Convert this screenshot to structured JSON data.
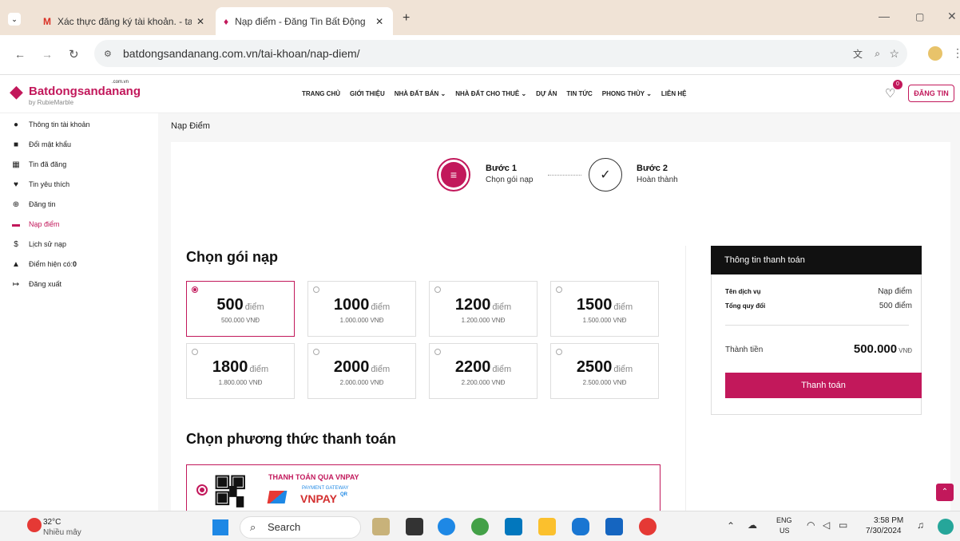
{
  "browser": {
    "tabs": [
      {
        "title": "Xác thực đăng ký tài khoản. - ta"
      },
      {
        "title": "Nạp điểm - Đăng Tin Bất Động"
      }
    ],
    "url": "batdongsandanang.com.vn/tai-khoan/nap-diem/"
  },
  "site": {
    "logo_main": "Batdongsandanang",
    "logo_tld": ".com.vn",
    "logo_sub": "by RubieMarble",
    "nav": [
      "TRANG CHỦ",
      "GIỚI THIỆU",
      "NHÀ ĐẤT BÁN",
      "NHÀ ĐẤT CHO THUÊ",
      "DỰ ÁN",
      "TIN TỨC",
      "PHONG THỦY",
      "LIÊN HỆ"
    ],
    "fav_count": "0",
    "post_button": "ĐĂNG TIN"
  },
  "sidebar": {
    "items": [
      {
        "label": "Thông tin tài khoản"
      },
      {
        "label": "Đổi mật khẩu"
      },
      {
        "label": "Tin đã đăng"
      },
      {
        "label": "Tin yêu thích"
      },
      {
        "label": "Đăng tin"
      },
      {
        "label": "Nạp điểm"
      },
      {
        "label": "Lịch sử nạp"
      },
      {
        "label": "Điểm hiện có: "
      },
      {
        "label": "Đăng xuất"
      }
    ],
    "points_value": "0"
  },
  "page": {
    "title": "Nạp Điểm",
    "steps": [
      {
        "title": "Bước 1",
        "desc": "Chọn gói nạp"
      },
      {
        "title": "Bước 2",
        "desc": "Hoàn thành"
      }
    ],
    "choose_package": "Chọn gói nạp",
    "unit": "điểm",
    "packages": [
      {
        "points": "500",
        "price": "500.000 VNĐ",
        "selected": true
      },
      {
        "points": "1000",
        "price": "1.000.000 VNĐ",
        "selected": false
      },
      {
        "points": "1200",
        "price": "1.200.000 VNĐ",
        "selected": false
      },
      {
        "points": "1500",
        "price": "1.500.000 VNĐ",
        "selected": false
      },
      {
        "points": "1800",
        "price": "1.800.000 VNĐ",
        "selected": false
      },
      {
        "points": "2000",
        "price": "2.000.000 VNĐ",
        "selected": false
      },
      {
        "points": "2200",
        "price": "2.200.000 VNĐ",
        "selected": false
      },
      {
        "points": "2500",
        "price": "2.500.000 VNĐ",
        "selected": false
      }
    ],
    "choose_method": "Chọn phương thức thanh toán",
    "vnpay_title": "THANH TOÁN QUA VNPAY",
    "vnpay_gateway": "PAYMENT GATEWAY",
    "vnpay_brand": "VNPAY",
    "vnpay_qr": "QR"
  },
  "payment": {
    "header": "Thông tin thanh toán",
    "service_label": "Tên dịch vụ",
    "service_value": "Nạp điểm",
    "exchange_label": "Tổng quy đổi",
    "exchange_value": "500 điểm",
    "total_label": "Thành tiền",
    "total_value": "500.000",
    "total_unit": "VNĐ",
    "pay_button": "Thanh toán"
  },
  "taskbar": {
    "weather_temp": "32°C",
    "weather_desc": "Nhiều mây",
    "search": "Search",
    "lang1": "ENG",
    "lang2": "US",
    "time": "3:58 PM",
    "date": "7/30/2024"
  },
  "colors": {
    "brand": "#c2185b",
    "dark": "#111111"
  }
}
